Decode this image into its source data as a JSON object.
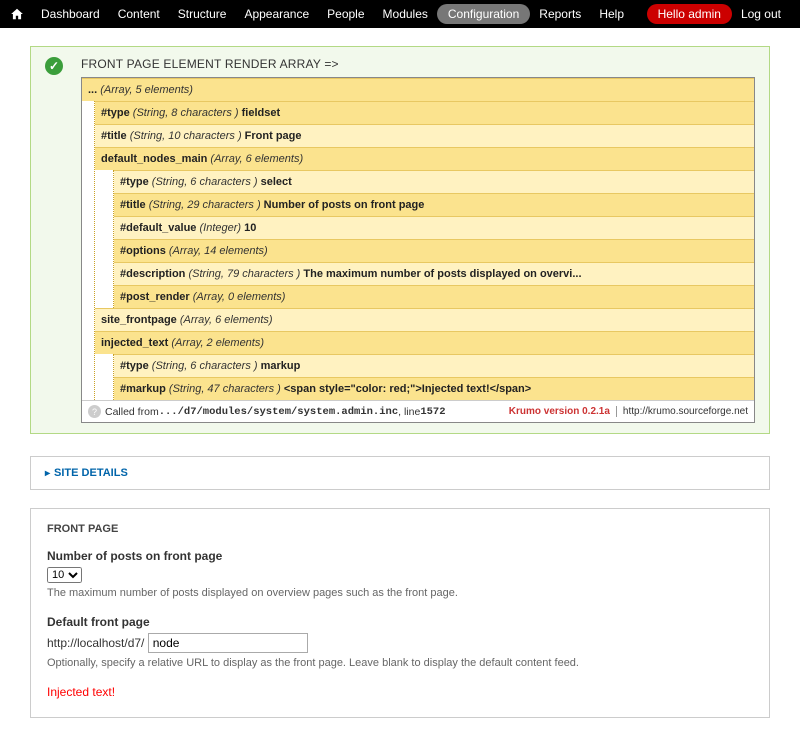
{
  "toolbar": {
    "items": [
      "Dashboard",
      "Content",
      "Structure",
      "Appearance",
      "People",
      "Modules",
      "Configuration",
      "Reports",
      "Help"
    ],
    "active_index": 6,
    "hello": "Hello admin",
    "logout": "Log out"
  },
  "status": {
    "title": "FRONT PAGE element RENDER ARRAY =>"
  },
  "krumo": {
    "root": {
      "key": "...",
      "type": "(Array, 5 elements)"
    },
    "rows": [
      {
        "indent": 1,
        "key": "#type",
        "type": "(String, 8 characters )",
        "val": "fieldset"
      },
      {
        "indent": 1,
        "key": "#title",
        "type": "(String, 10 characters )",
        "val": "Front page"
      },
      {
        "indent": 1,
        "key": "default_nodes_main",
        "type": "(Array, 6 elements)",
        "val": ""
      },
      {
        "indent": 2,
        "key": "#type",
        "type": "(String, 6 characters )",
        "val": "select"
      },
      {
        "indent": 2,
        "key": "#title",
        "type": "(String, 29 characters )",
        "val": "Number of posts on front page"
      },
      {
        "indent": 2,
        "key": "#default_value",
        "type": "(Integer)",
        "val": "10"
      },
      {
        "indent": 2,
        "key": "#options",
        "type": "(Array, 14 elements)",
        "val": ""
      },
      {
        "indent": 2,
        "key": "#description",
        "type": "(String, 79 characters )",
        "val": "The maximum number of posts displayed on overvi..."
      },
      {
        "indent": 2,
        "key": "#post_render",
        "type": "(Array, 0 elements)",
        "val": ""
      },
      {
        "indent": 1,
        "key": "site_frontpage",
        "type": "(Array, 6 elements)",
        "val": ""
      },
      {
        "indent": 1,
        "key": "injected_text",
        "type": "(Array, 2 elements)",
        "val": ""
      },
      {
        "indent": 2,
        "key": "#type",
        "type": "(String, 6 characters )",
        "val": "markup"
      },
      {
        "indent": 2,
        "key": "#markup",
        "type": "(String, 47 characters )",
        "val": "<span style=\"color: red;\">Injected text!</span>"
      }
    ],
    "footer": {
      "called": "Called from ",
      "path": ".../d7/modules/system/system.admin.inc",
      "line_label": ", line ",
      "line": "1572",
      "version": "Krumo version 0.2.1a",
      "link": "http://krumo.sourceforge.net"
    }
  },
  "fieldsets": {
    "site_details_label": "SITE DETAILS",
    "front_page": {
      "legend": "FRONT PAGE",
      "posts_label": "Number of posts on front page",
      "posts_value": "10",
      "posts_desc": "The maximum number of posts displayed on overview pages such as the front page.",
      "default_fp_label": "Default front page",
      "base_url": "http://localhost/d7/ ",
      "path_value": "node",
      "path_desc": "Optionally, specify a relative URL to display as the front page. Leave blank to display the default content feed.",
      "injected": "Injected text!"
    }
  }
}
